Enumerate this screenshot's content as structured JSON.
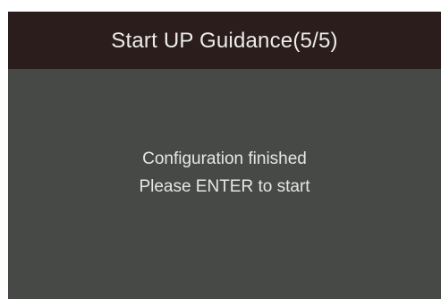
{
  "dialog": {
    "title": "Start UP Guidance(5/5)",
    "message_line1": "Configuration finished",
    "message_line2": "Please ENTER to start"
  },
  "colors": {
    "title_bar": "#2a1d1b",
    "panel": "#474947",
    "text": "#ececec"
  }
}
